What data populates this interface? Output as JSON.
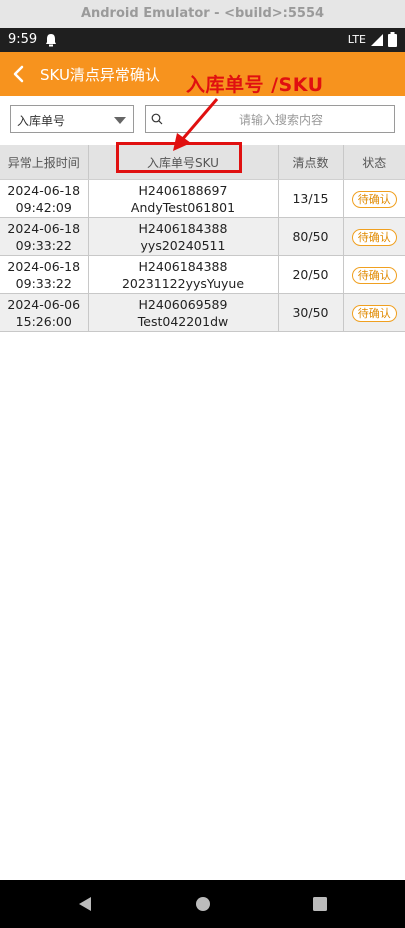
{
  "emulator": {
    "title": "Android Emulator - <build>:5554"
  },
  "status_bar": {
    "time": "9:59",
    "network": "LTE"
  },
  "app_bar": {
    "title": "SKU清点异常确认"
  },
  "annotation": {
    "text": "入库单号 /SKU"
  },
  "filter": {
    "select_value": "入库单号",
    "search_placeholder": "请输入搜索内容"
  },
  "table": {
    "headers": [
      "异常上报时间",
      "入库单号SKU",
      "清点数",
      "状态"
    ],
    "rows": [
      {
        "date": "2024-06-18",
        "time": "09:42:09",
        "order": "H2406188697",
        "sku": "AndyTest061801",
        "count": "13/15",
        "status": "待确认"
      },
      {
        "date": "2024-06-18",
        "time": "09:33:22",
        "order": "H2406184388",
        "sku": "yys20240511",
        "count": "80/50",
        "status": "待确认"
      },
      {
        "date": "2024-06-18",
        "time": "09:33:22",
        "order": "H2406184388",
        "sku": "20231122yysYuyue",
        "count": "20/50",
        "status": "待确认"
      },
      {
        "date": "2024-06-06",
        "time": "15:26:00",
        "order": "H2406069589",
        "sku": "Test042201dw",
        "count": "30/50",
        "status": "待确认"
      }
    ]
  },
  "colors": {
    "app_bar": "#f7931e",
    "annotation": "#e01010",
    "badge": "#f0a020"
  },
  "icons": {
    "back": "chevron-left-icon",
    "search": "search-icon",
    "nav_back": "triangle-back-icon",
    "nav_home": "circle-home-icon",
    "nav_recents": "square-recents-icon"
  }
}
